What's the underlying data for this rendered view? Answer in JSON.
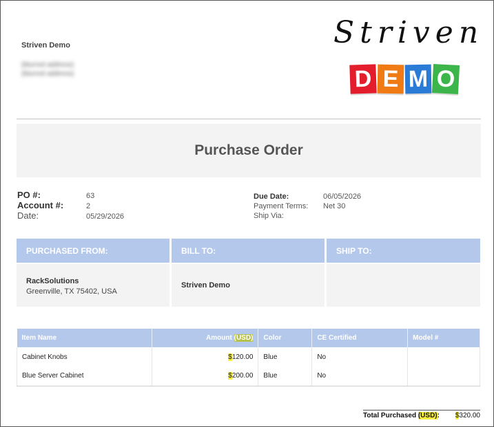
{
  "company": {
    "name": "Striven Demo",
    "address_line1": "(blurred address)",
    "address_line2": "(blurred address)"
  },
  "logo": {
    "script_text": "Striven",
    "tiles": [
      "D",
      "E",
      "M",
      "O"
    ],
    "tile_colors": [
      "#e31d2b",
      "#f07a13",
      "#2a7bd6",
      "#3cb64a"
    ]
  },
  "title": "Purchase Order",
  "meta": {
    "po_label": "PO #:",
    "po_value": "63",
    "account_label": "Account #:",
    "account_value": "2",
    "date_label": "Date:",
    "date_value": "05/29/2026",
    "due_date_label": "Due Date:",
    "due_date_value": "06/05/2026",
    "payment_terms_label": "Payment Terms:",
    "payment_terms_value": "Net 30",
    "ship_via_label": "Ship Via:",
    "ship_via_value": ""
  },
  "addresses": {
    "purchased_from_label": "PURCHASED FROM:",
    "purchased_from_name": "RackSolutions",
    "purchased_from_city": "Greenville, TX 75402, USA",
    "bill_to_label": "BILL TO:",
    "bill_to_name": "Striven Demo",
    "ship_to_label": "SHIP TO:"
  },
  "items": {
    "columns": {
      "item_name": "Item Name",
      "amount": "Amount",
      "currency": "(USD)",
      "color": "Color",
      "ce_certified": "CE Certified",
      "model": "Model #"
    },
    "rows": [
      {
        "name": "Cabinet Knobs",
        "currency_symbol": "$",
        "amount": "120.00",
        "color": "Blue",
        "ce": "No",
        "model": ""
      },
      {
        "name": "Blue Server Cabinet",
        "currency_symbol": "$",
        "amount": "200.00",
        "color": "Blue",
        "ce": "No",
        "model": ""
      }
    ]
  },
  "total": {
    "label_prefix": "Total Purchased",
    "currency": "(USD)",
    "colon": ":",
    "currency_symbol": "$",
    "value": "320.00"
  },
  "colors": {
    "header_blue": "#b4c8ec",
    "band_gray": "#f3f3f3",
    "highlight": "#f7ef3a"
  }
}
